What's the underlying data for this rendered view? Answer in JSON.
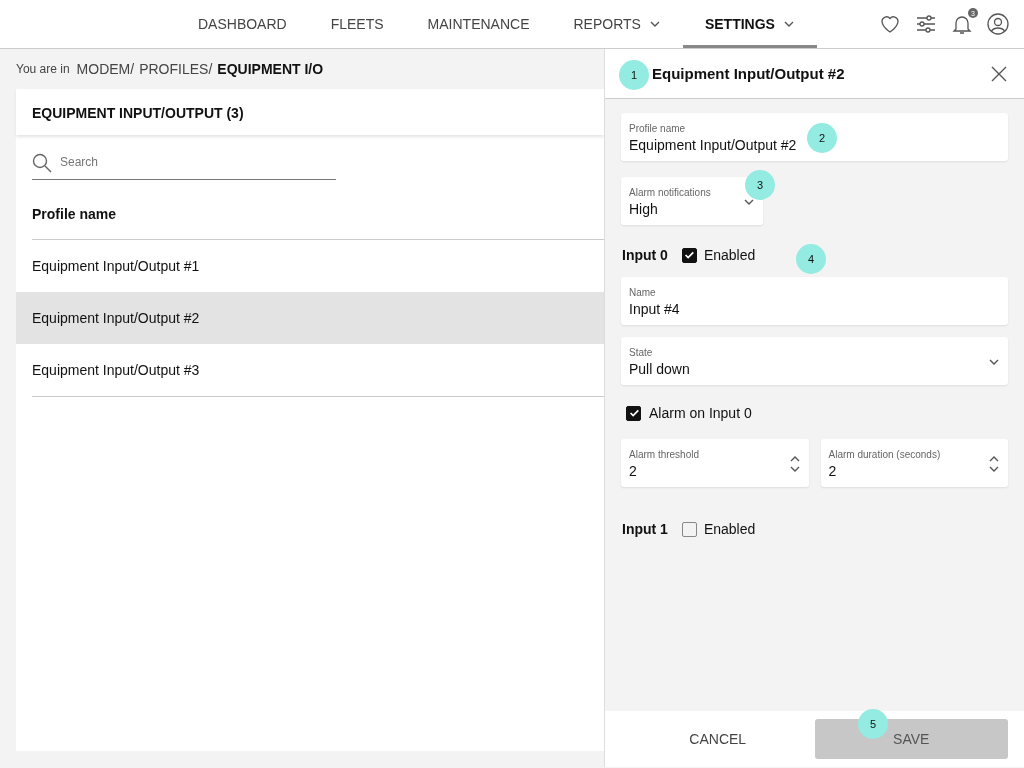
{
  "nav": {
    "items": [
      {
        "label": "DASHBOARD",
        "selected": false,
        "dropdown": false
      },
      {
        "label": "FLEETS",
        "selected": false,
        "dropdown": false
      },
      {
        "label": "MAINTENANCE",
        "selected": false,
        "dropdown": false
      },
      {
        "label": "REPORTS",
        "selected": false,
        "dropdown": true
      },
      {
        "label": "SETTINGS",
        "selected": true,
        "dropdown": true
      }
    ],
    "notification_count": "3"
  },
  "breadcrumb": {
    "prefix": "You are in",
    "path": [
      "MODEM/",
      "PROFILES/"
    ],
    "current": "EQUIPMENT I/O"
  },
  "list": {
    "title": "EQUIPMENT INPUT/OUTPUT (3)",
    "search": {
      "placeholder": "Search"
    },
    "column": "Profile name",
    "rows": [
      {
        "label": "Equipment Input/Output #1",
        "selected": false
      },
      {
        "label": "Equipment Input/Output #2",
        "selected": true
      },
      {
        "label": "Equipment Input/Output #3",
        "selected": false
      }
    ]
  },
  "panel": {
    "title": "Equipment Input/Output #2",
    "profile_name": {
      "label": "Profile name",
      "value": "Equipment Input/Output #2"
    },
    "alarm_notifications": {
      "label": "Alarm notifications",
      "value": "High"
    },
    "inputs": [
      {
        "label": "Input 0",
        "enabled_label": "Enabled",
        "enabled": true,
        "name": {
          "label": "Name",
          "value": "Input #4"
        },
        "state": {
          "label": "State",
          "value": "Pull down"
        },
        "alarm": {
          "label": "Alarm on Input 0",
          "checked": true
        },
        "threshold": {
          "label": "Alarm threshold",
          "value": "2"
        },
        "duration": {
          "label": "Alarm duration (seconds)",
          "value": "2"
        }
      },
      {
        "label": "Input 1",
        "enabled_label": "Enabled",
        "enabled": false
      }
    ],
    "buttons": {
      "cancel": "CANCEL",
      "save": {
        "label": "SAVE",
        "disabled": true
      }
    }
  },
  "markers": [
    "1",
    "2",
    "3",
    "4",
    "5"
  ]
}
